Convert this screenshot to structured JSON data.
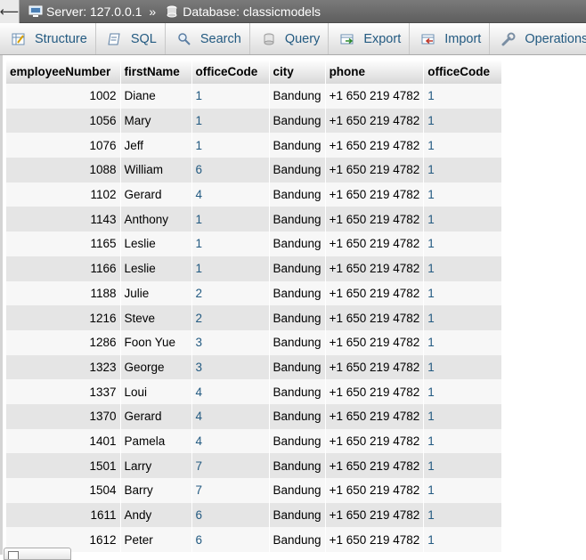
{
  "breadcrumb": {
    "server": "Server: 127.0.0.1",
    "separator": "»",
    "database": "Database: classicmodels"
  },
  "tabs": [
    {
      "label": "Structure",
      "icon": "structure-icon"
    },
    {
      "label": "SQL",
      "icon": "sql-icon"
    },
    {
      "label": "Search",
      "icon": "search-icon"
    },
    {
      "label": "Query",
      "icon": "query-icon"
    },
    {
      "label": "Export",
      "icon": "export-icon"
    },
    {
      "label": "Import",
      "icon": "import-icon"
    },
    {
      "label": "Operations",
      "icon": "wrench-icon"
    }
  ],
  "table": {
    "headers": [
      "employeeNumber",
      "firstName",
      "officeCode",
      "city",
      "phone",
      "officeCode"
    ],
    "rows": [
      [
        "1002",
        "Diane",
        "1",
        "Bandung",
        "+1 650 219 4782",
        "1"
      ],
      [
        "1056",
        "Mary",
        "1",
        "Bandung",
        "+1 650 219 4782",
        "1"
      ],
      [
        "1076",
        "Jeff",
        "1",
        "Bandung",
        "+1 650 219 4782",
        "1"
      ],
      [
        "1088",
        "William",
        "6",
        "Bandung",
        "+1 650 219 4782",
        "1"
      ],
      [
        "1102",
        "Gerard",
        "4",
        "Bandung",
        "+1 650 219 4782",
        "1"
      ],
      [
        "1143",
        "Anthony",
        "1",
        "Bandung",
        "+1 650 219 4782",
        "1"
      ],
      [
        "1165",
        "Leslie",
        "1",
        "Bandung",
        "+1 650 219 4782",
        "1"
      ],
      [
        "1166",
        "Leslie",
        "1",
        "Bandung",
        "+1 650 219 4782",
        "1"
      ],
      [
        "1188",
        "Julie",
        "2",
        "Bandung",
        "+1 650 219 4782",
        "1"
      ],
      [
        "1216",
        "Steve",
        "2",
        "Bandung",
        "+1 650 219 4782",
        "1"
      ],
      [
        "1286",
        "Foon Yue",
        "3",
        "Bandung",
        "+1 650 219 4782",
        "1"
      ],
      [
        "1323",
        "George",
        "3",
        "Bandung",
        "+1 650 219 4782",
        "1"
      ],
      [
        "1337",
        "Loui",
        "4",
        "Bandung",
        "+1 650 219 4782",
        "1"
      ],
      [
        "1370",
        "Gerard",
        "4",
        "Bandung",
        "+1 650 219 4782",
        "1"
      ],
      [
        "1401",
        "Pamela",
        "4",
        "Bandung",
        "+1 650 219 4782",
        "1"
      ],
      [
        "1501",
        "Larry",
        "7",
        "Bandung",
        "+1 650 219 4782",
        "1"
      ],
      [
        "1504",
        "Barry",
        "7",
        "Bandung",
        "+1 650 219 4782",
        "1"
      ],
      [
        "1611",
        "Andy",
        "6",
        "Bandung",
        "+1 650 219 4782",
        "1"
      ],
      [
        "1612",
        "Peter",
        "6",
        "Bandung",
        "+1 650 219 4782",
        "1"
      ]
    ]
  },
  "colors": {
    "link": "#235a81",
    "row_odd": "#f7f7f7",
    "row_even": "#e5e5e5"
  }
}
